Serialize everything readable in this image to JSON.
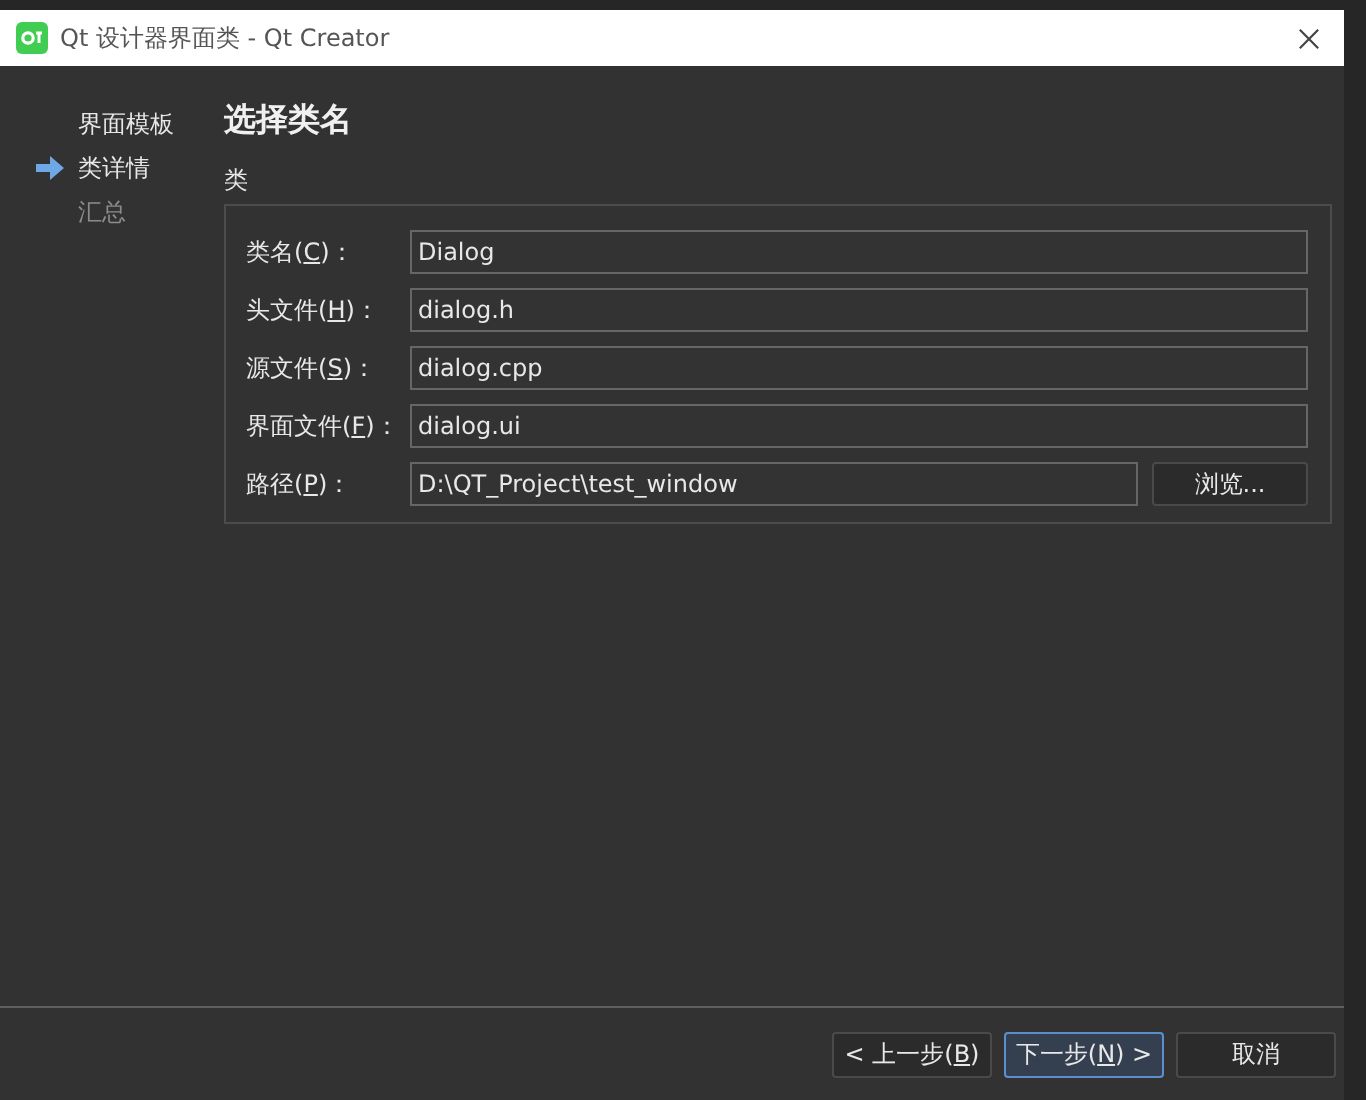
{
  "window": {
    "title": "Qt 设计器界面类 - Qt Creator"
  },
  "steps": [
    {
      "label": "界面模板",
      "done": true,
      "current": false
    },
    {
      "label": "类详情",
      "done": false,
      "current": true
    },
    {
      "label": "汇总",
      "done": false,
      "current": false
    }
  ],
  "page": {
    "heading": "选择类名",
    "group_title": "类",
    "fields": [
      {
        "label": [
          "类名(",
          "C",
          ")："
        ],
        "value": "Dialog"
      },
      {
        "label": [
          "头文件(",
          "H",
          ")："
        ],
        "value": "dialog.h"
      },
      {
        "label": [
          "源文件(",
          "S",
          ")："
        ],
        "value": "dialog.cpp"
      },
      {
        "label": [
          "界面文件(",
          "F",
          ")："
        ],
        "value": "dialog.ui"
      },
      {
        "label": [
          "路径(",
          "P",
          ")："
        ],
        "value": "D:\\QT_Project\\test_window",
        "browse": "浏览..."
      }
    ]
  },
  "buttons": [
    {
      "label": [
        "< 上一步(",
        "B",
        ")"
      ],
      "default": false
    },
    {
      "label": [
        "下一步(",
        "N",
        ") >"
      ],
      "default": true
    },
    {
      "label": [
        "取消"
      ],
      "default": false
    }
  ]
}
